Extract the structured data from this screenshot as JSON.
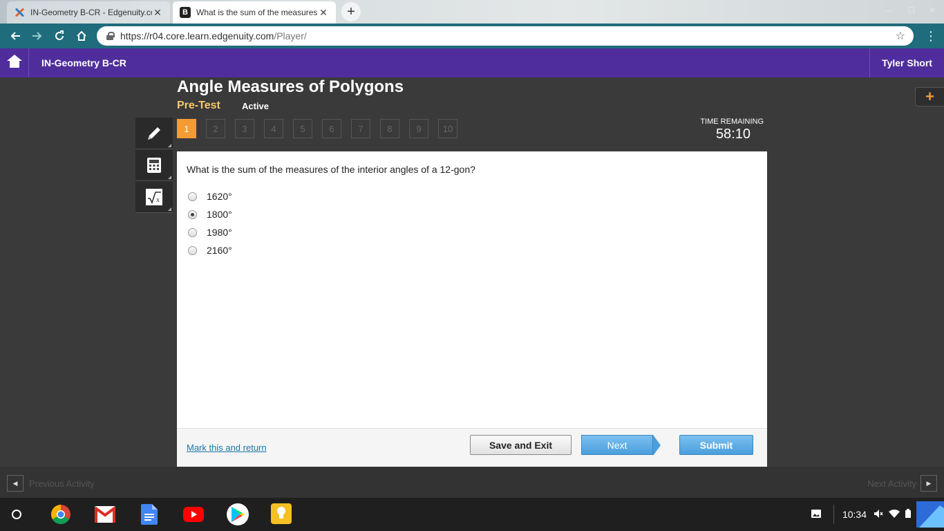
{
  "browser": {
    "tabs": [
      {
        "title": "IN-Geometry B-CR - Edgenuity.com",
        "icon": "edgenuity-icon"
      },
      {
        "title": "What is the sum of the measures",
        "icon": "brainly-icon"
      }
    ],
    "url_host": "https://r04.core.learn.edgenuity.com",
    "url_path": "/Player/"
  },
  "header": {
    "course": "IN-Geometry B-CR",
    "user": "Tyler Short",
    "accent": "#4f2d9b"
  },
  "lesson": {
    "title": "Angle Measures of Polygons",
    "activity": "Pre-Test",
    "status": "Active"
  },
  "question_nav": [
    "1",
    "2",
    "3",
    "4",
    "5",
    "6",
    "7",
    "8",
    "9",
    "10"
  ],
  "timer": {
    "label": "TIME REMAINING",
    "value": "58:10"
  },
  "question": {
    "prompt": "What is the sum of the measures of the interior angles of a 12-gon?",
    "options": [
      "1620°",
      "1800°",
      "1980°",
      "2160°"
    ],
    "selected_index": 1
  },
  "footer": {
    "mark_link": "Mark this and return",
    "save_exit": "Save and Exit",
    "next": "Next",
    "submit": "Submit"
  },
  "activity_nav": {
    "prev": "Previous Activity",
    "next": "Next Activity"
  },
  "shelf": {
    "time": "10:34"
  }
}
